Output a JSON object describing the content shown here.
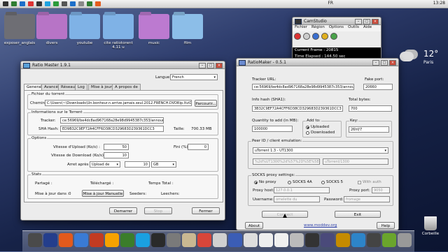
{
  "menubar": {
    "lang": "FR",
    "clock": "13:28"
  },
  "desktop": {
    "folders": [
      {
        "label": "exposer_anglais",
        "color": "#6e6e74"
      },
      {
        "label": "divers",
        "color": "#b774c6"
      },
      {
        "label": "youtube",
        "color": "#7fb2e6"
      },
      {
        "label": "cite ratiotorent 4.11 u",
        "color": "#7fb2e6"
      },
      {
        "label": "music",
        "color": "#bc7ad0"
      },
      {
        "label": "film",
        "color": "#8cbee8"
      }
    ],
    "weather": {
      "temp": "12°",
      "city": "Paris"
    },
    "trash_label": "Corbeille"
  },
  "camstudio": {
    "title": "CamStudio",
    "menu": [
      "Fichier",
      "Région",
      "Options",
      "Outils",
      "Aide"
    ],
    "current_frame": "Current Frame : 20815",
    "time_elapsed": "Time Elapsed : 144.50 sec"
  },
  "ratiomaster": {
    "title": "Ratio Master 1.9.1",
    "language_label": "Langue:",
    "language_value": "French",
    "tabs": [
      "General",
      "Avancé",
      "Réseau",
      "Log",
      "Mise à jour",
      "A propos de"
    ],
    "torrent_file_group": "Fichier du torrent",
    "path_label": "Chemin",
    "path_value": "C:\\Users\\~\\Downloads\\Un.bonheur.n.arrive.jamais.seul.2012.FRENCH.DVDRip.XviD.torrent",
    "browse_btn": "Parcourir...",
    "info_group": "Informations sur le Torrent",
    "tracker_label": "Tracker:",
    "tracker_value": "ce:56969/be4dc8ad967168a28e98d9945387c353/announce",
    "sha_label": "SHA Hash:",
    "sha_value": "ED9B32C9EF72A4CFF6D38CD329683D239361DCC3",
    "size_label": "Taille:",
    "size_value": "700.33 MB",
    "options_group": "Options",
    "upload_speed_label": "Vitesse d'Upload (Ko/s) :",
    "upload_speed_value": "50",
    "download_speed_label": "Vitesse de Download (Ko/s) :",
    "download_speed_value": "10",
    "end_label": "Fini (%) :",
    "end_value": "0",
    "stop_label": "Arret après :",
    "stop_select": "Upload de",
    "stop_amount": "10",
    "stop_unit": "GB",
    "stats_group": "Stats",
    "shared_label": "Partagé :",
    "downloaded_label": "Téléchargé :",
    "total_time_label": "Temps Total :",
    "update_in_label": "Mise à jour dans :",
    "update_in_value": "0",
    "manual_update_btn": "Mise à jour Manuelle",
    "seeders_label": "Seeders:",
    "leechers_label": "Leechers:",
    "start_btn": "Demarrer",
    "stop_btn": "Stop",
    "close_btn": "Fermer"
  },
  "ratiomaker": {
    "title": "RatioMaker - 0.5.1",
    "tracker_url_label": "Tracker URL:",
    "tracker_url_value": "ce:56969/be4dc8ad967168a28e98d9945387c353/announce",
    "fake_port_label": "Fake port:",
    "fake_port_value": "20660",
    "info_hash_label": "Info hash (SHA1):",
    "info_hash_value": "3B32C9EF72A4CFF6D38CD329683D239361DCC3",
    "total_bytes_label": "Total bytes:",
    "total_bytes_value": "700",
    "quantity_label": "Quantity to add (in MB):",
    "quantity_value": "100000",
    "add_to_label": "Add to:",
    "uploaded_option": "Uploaded",
    "downloaded_option": "Downloaded",
    "key_label": "Key:",
    "key_value": "26hf/7",
    "peer_id_label": "Peer ID / client emulation:",
    "client_value": "uTorrent 1.3 - UT1300",
    "peer_id_value": "%2d%UT1300%2d%57%2D%5E%5E057C%3",
    "client_string": "uTorrent/1300",
    "socks_label": "SOCKS proxy settings:",
    "no_proxy": "No proxy",
    "socks4": "SOCKS 4A",
    "socks5": "SOCKS 5",
    "with_auth": "With auth",
    "proxy_host_label": "Proxy host:",
    "proxy_host_value": "127.0.0.1",
    "proxy_port_label": "Proxy port:",
    "proxy_port_value": "9050",
    "username_label": "Username:",
    "username_value": "omelette du",
    "password_label": "Password:",
    "password_value": "fromage",
    "connect_btn": "Connect",
    "exit_btn": "Exit",
    "about_btn": "About",
    "link": "www.moddev.org",
    "help_btn": "Help"
  },
  "dock": {
    "icon_colors": [
      "#4a4a4a",
      "#243e8c",
      "#e25a1c",
      "#3a7bd5",
      "#c23b22",
      "#f7a200",
      "#3b7d2a",
      "#1aa0e0",
      "#2a2a2a",
      "#7a7a7a",
      "#c9b892",
      "#d8463a",
      "#d0d0d0",
      "#3b5db5",
      "#ddd",
      "#eee",
      "#f0f0f0",
      "#bbb",
      "#333",
      "#4a4a7a",
      "#c58b00",
      "#2d84c9",
      "#444",
      "#6aa52c",
      "#999"
    ]
  }
}
